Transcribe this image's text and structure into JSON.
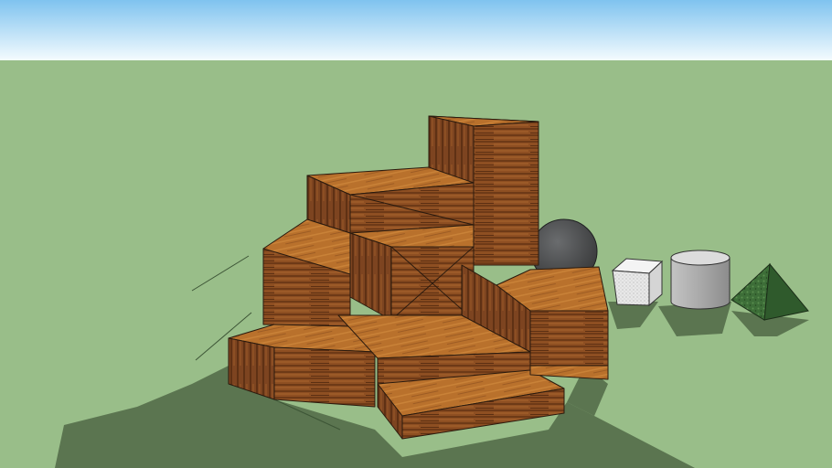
{
  "scene": {
    "kind": "3d-model-viewport",
    "colors": {
      "sky_top": "#7fc3ef",
      "sky_bottom": "#f4fbfe",
      "ground": "#99be89",
      "shadow": "#5b7550",
      "wood_light": "#b9712c",
      "wood_mid": "#8e4f22",
      "wood_dark": "#6a3818",
      "sphere": "#4b4d4f",
      "cube": "#e6e6e6",
      "cylinder": "#b3b3b3",
      "pyramid": "#3b6b37"
    },
    "objects": [
      {
        "name": "stacked-wood-blocks",
        "material": "wood"
      },
      {
        "name": "dark-sphere",
        "material": "stone"
      },
      {
        "name": "white-cube",
        "material": "textured-white"
      },
      {
        "name": "grey-cylinder",
        "material": "grey"
      },
      {
        "name": "green-pyramid",
        "material": "green-marble"
      }
    ]
  }
}
